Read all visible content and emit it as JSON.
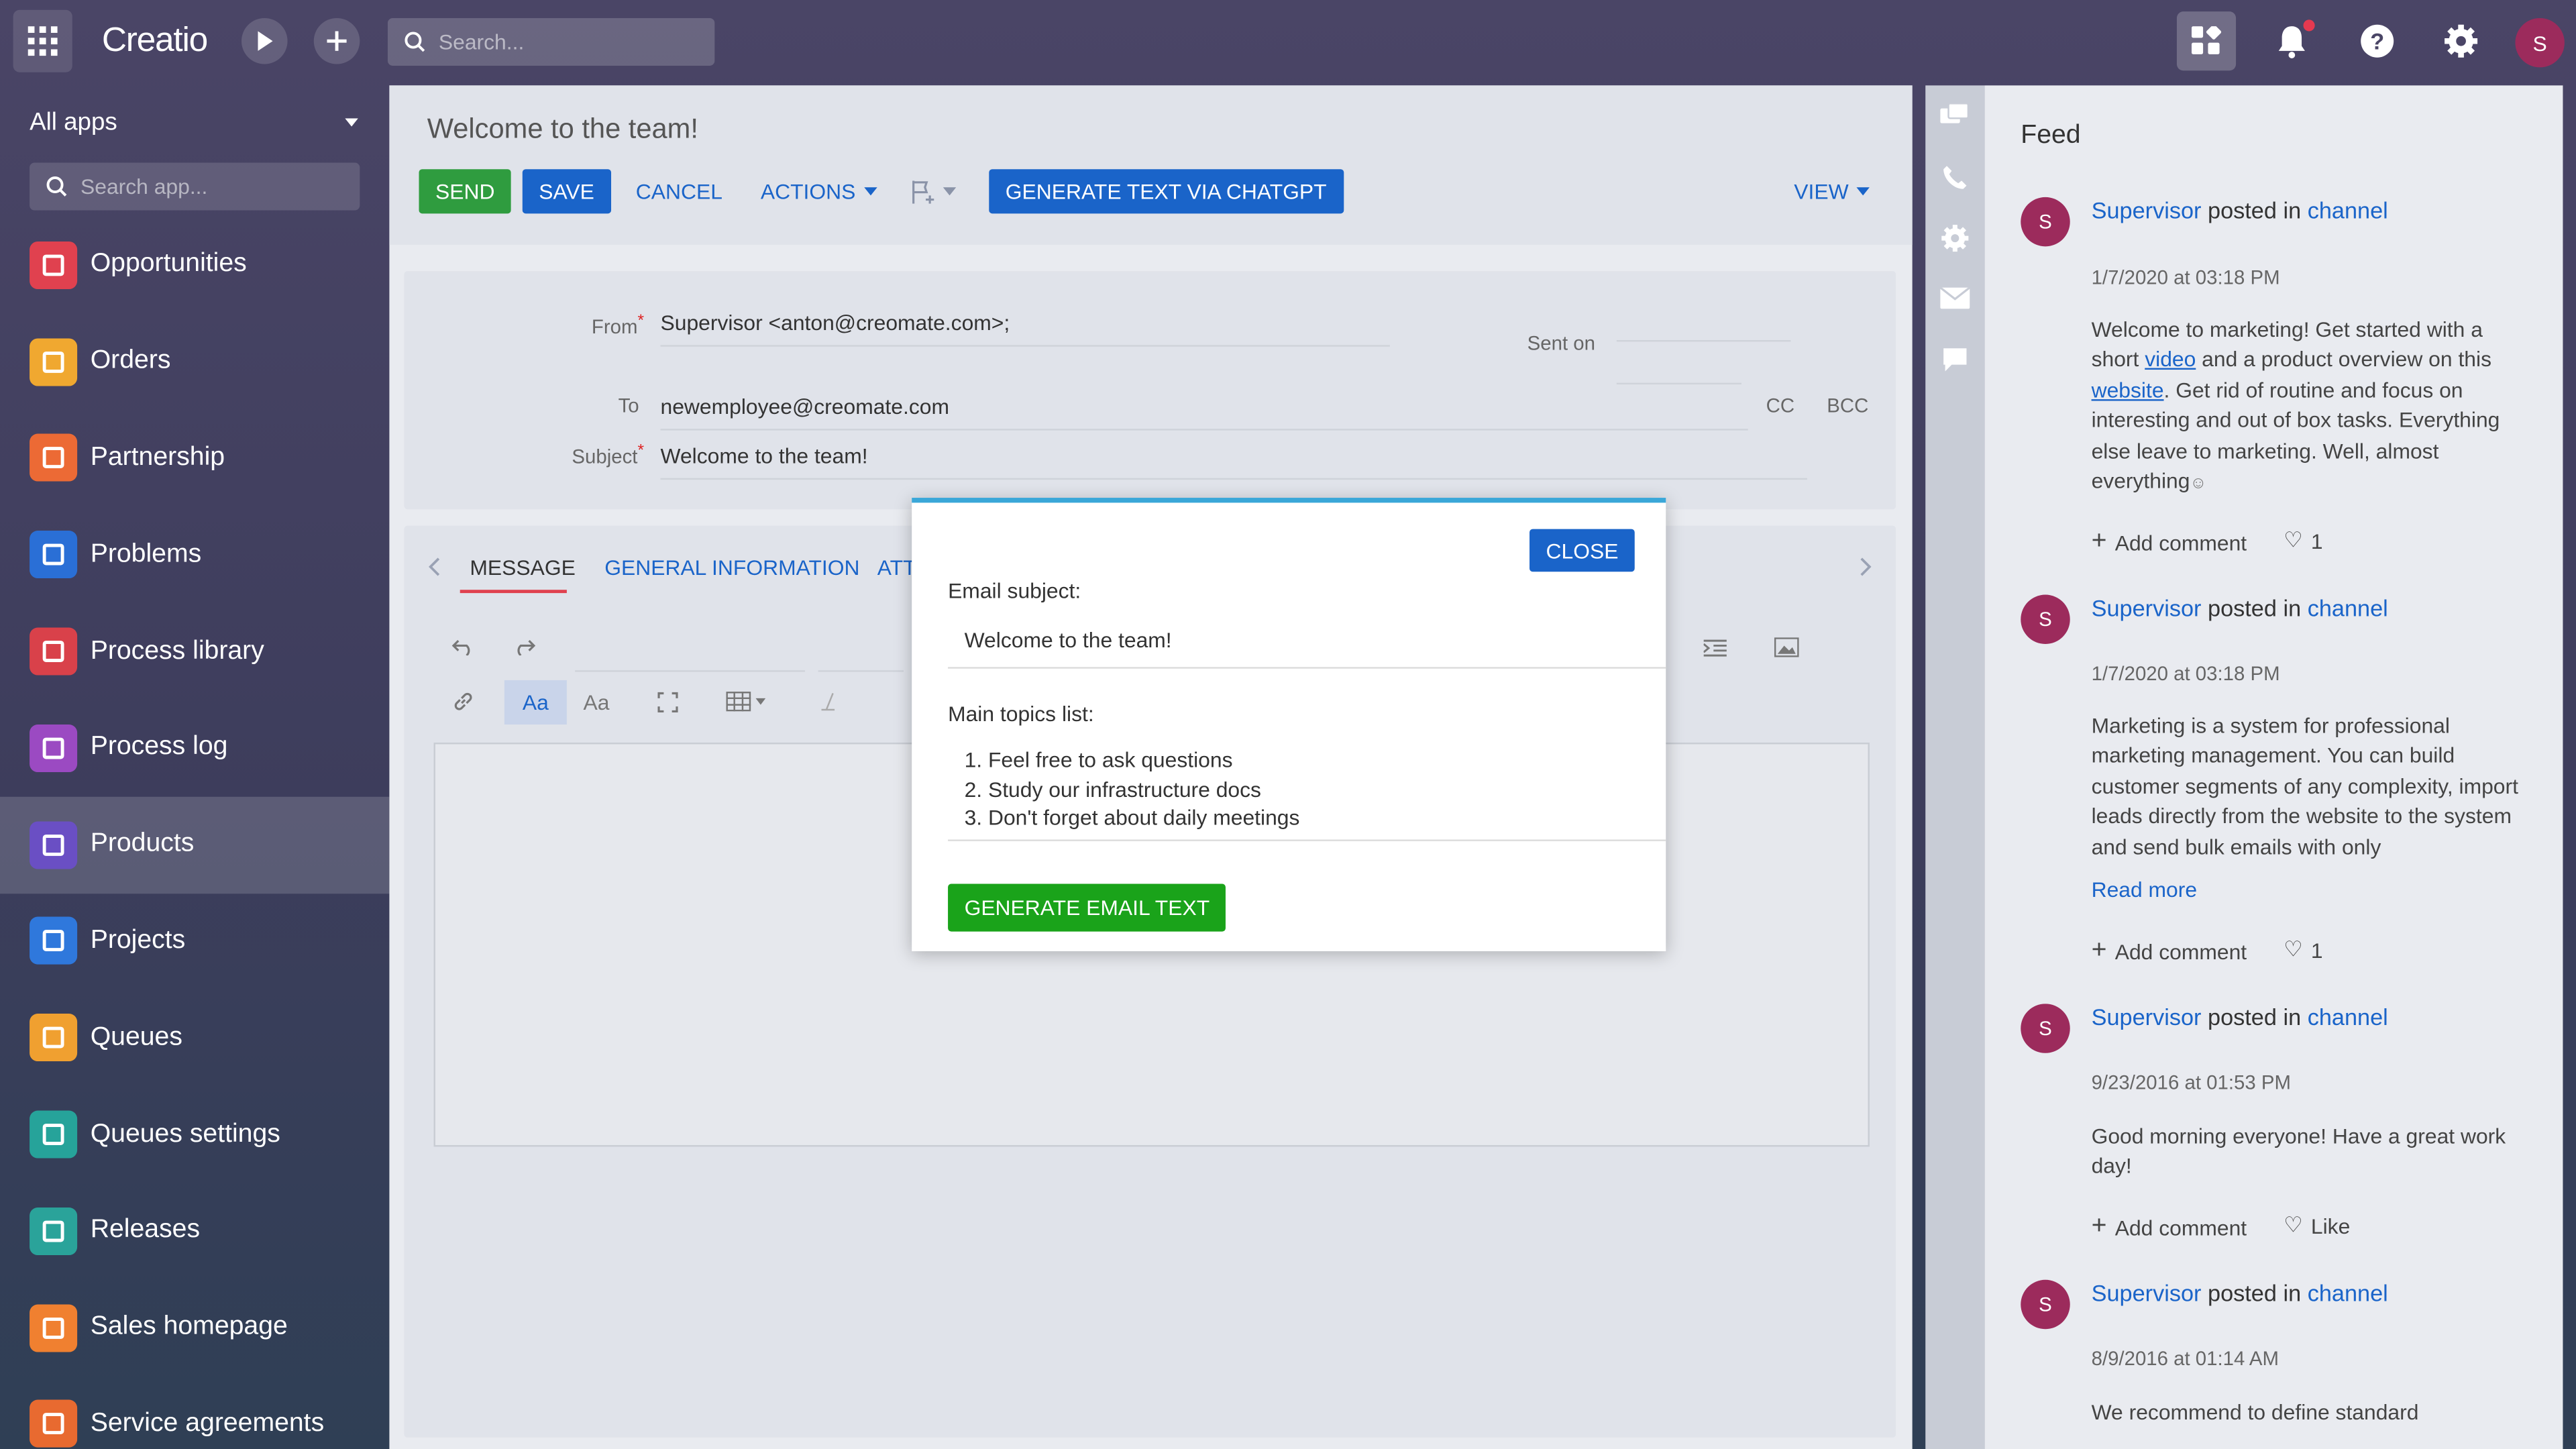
{
  "topbar": {
    "logo": "Creatio",
    "search_placeholder": "Search...",
    "avatar_letter": "S"
  },
  "sidebar": {
    "title": "All apps",
    "search_placeholder": "Search app...",
    "items": [
      {
        "label": "Opportunities",
        "color": "#e0414f"
      },
      {
        "label": "Orders",
        "color": "#f0a830"
      },
      {
        "label": "Partnership",
        "color": "#ec6a35"
      },
      {
        "label": "Problems",
        "color": "#2a6fd6"
      },
      {
        "label": "Process library",
        "color": "#d9414a"
      },
      {
        "label": "Process log",
        "color": "#9b4ac2"
      },
      {
        "label": "Products",
        "color": "#6a4fc4"
      },
      {
        "label": "Projects",
        "color": "#2f78dc"
      },
      {
        "label": "Queues",
        "color": "#f0a030"
      },
      {
        "label": "Queues settings",
        "color": "#26a39a"
      },
      {
        "label": "Releases",
        "color": "#2aa39a"
      },
      {
        "label": "Sales homepage",
        "color": "#f08030"
      },
      {
        "label": "Service agreements",
        "color": "#e86a30"
      }
    ],
    "active_index": 6
  },
  "page": {
    "title": "Welcome to the team!",
    "buttons": {
      "send": "SEND",
      "save": "SAVE",
      "cancel": "CANCEL",
      "actions": "ACTIONS",
      "chatgpt": "GENERATE TEXT VIA CHATGPT",
      "view": "VIEW"
    },
    "fields": {
      "from_label": "From",
      "from_value": "Supervisor <anton@creomate.com>;",
      "sent_on_label": "Sent on",
      "to_label": "To",
      "to_value": "newemployee@creomate.com",
      "cc": "CC",
      "bcc": "BCC",
      "subject_label": "Subject",
      "subject_value": "Welcome to the team!"
    },
    "tabs": {
      "message": "MESSAGE",
      "general": "GENERAL INFORMATION",
      "attachments": "ATT"
    }
  },
  "modal": {
    "close": "CLOSE",
    "email_subject_label": "Email subject:",
    "email_subject_value": "Welcome to the team!",
    "topics_label": "Main topics list:",
    "topics": [
      "1. Feel free to ask questions",
      "2. Study our infrastructure docs",
      "3. Don't forget about daily meetings"
    ],
    "generate": "GENERATE EMAIL TEXT"
  },
  "feed": {
    "title": "Feed",
    "posts": [
      {
        "author": "Supervisor",
        "posted_in": "posted in",
        "channel": "channel",
        "date": "1/7/2020 at 03:18 PM",
        "body_parts": [
          "Welcome to marketing! Get started with a short ",
          "video",
          " and a product overview on this ",
          "website",
          ". Get rid of routine and focus on interesting and out of box tasks. Everything else leave to marketing. Well, almost everything"
        ],
        "add_comment": "Add comment",
        "likes": "1"
      },
      {
        "author": "Supervisor",
        "posted_in": "posted in",
        "channel": "channel",
        "date": "1/7/2020 at 03:18 PM",
        "body": "Marketing is a system for professional marketing management. You can build customer segments of any complexity, import leads directly from the website to the system and send bulk emails with only",
        "read_more": "Read more",
        "add_comment": "Add comment",
        "likes": "1"
      },
      {
        "author": "Supervisor",
        "posted_in": "posted in",
        "channel": "channel",
        "date": "9/23/2016 at 01:53 PM",
        "body": "Good morning everyone! Have a great work day!",
        "add_comment": "Add comment",
        "likes": "Like"
      },
      {
        "author": "Supervisor",
        "posted_in": "posted in",
        "channel": "channel",
        "date": "8/9/2016 at 01:14 AM",
        "body": "We recommend to define standard"
      }
    ]
  }
}
